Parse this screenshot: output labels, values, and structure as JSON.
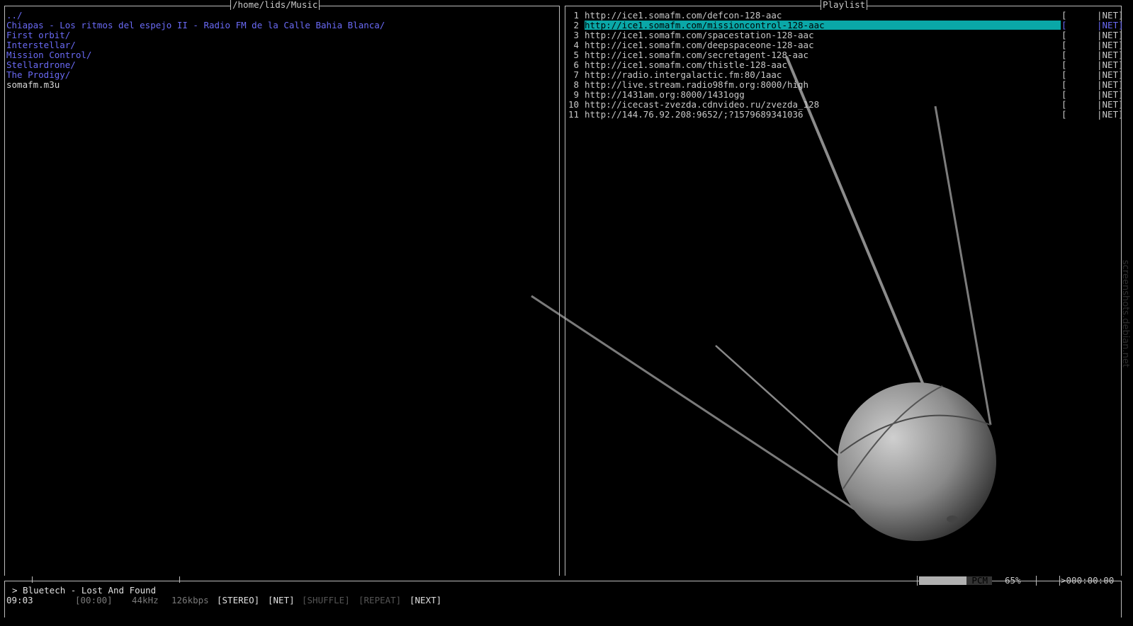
{
  "browser": {
    "title": "/home/lids/Music",
    "items": [
      {
        "name": "../",
        "type": "dir"
      },
      {
        "name": "Chiapas - Los ritmos del espejo II - Radio FM de la Calle Bahia Blanca/",
        "type": "dir"
      },
      {
        "name": "First orbit/",
        "type": "dir"
      },
      {
        "name": "Interstellar/",
        "type": "dir"
      },
      {
        "name": "Mission Control/",
        "type": "dir"
      },
      {
        "name": "Stellardrone/",
        "type": "dir"
      },
      {
        "name": "The Prodigy/",
        "type": "dir"
      },
      {
        "name": "somafm.m3u",
        "type": "file"
      }
    ]
  },
  "playlist": {
    "title": "Playlist",
    "selected_index": 1,
    "items": [
      {
        "num": "1",
        "url": "http://ice1.somafm.com/defcon-128-aac",
        "bracket": "[",
        "tag": "|NET]"
      },
      {
        "num": "2",
        "url": "http://ice1.somafm.com/missioncontrol-128-aac",
        "bracket": "[",
        "tag": "|NET]"
      },
      {
        "num": "3",
        "url": "http://ice1.somafm.com/spacestation-128-aac",
        "bracket": "[",
        "tag": "|NET]"
      },
      {
        "num": "4",
        "url": "http://ice1.somafm.com/deepspaceone-128-aac",
        "bracket": "[",
        "tag": "|NET]"
      },
      {
        "num": "5",
        "url": "http://ice1.somafm.com/secretagent-128-aac",
        "bracket": "[",
        "tag": "|NET]"
      },
      {
        "num": "6",
        "url": "http://ice1.somafm.com/thistle-128-aac",
        "bracket": "[",
        "tag": "|NET]"
      },
      {
        "num": "7",
        "url": "http://radio.intergalactic.fm:80/1aac",
        "bracket": "[",
        "tag": "|NET]"
      },
      {
        "num": "8",
        "url": "http://live.stream.radio98fm.org:8000/high",
        "bracket": "[",
        "tag": "|NET]"
      },
      {
        "num": "9",
        "url": "http://1431am.org:8000/1431ogg",
        "bracket": "[",
        "tag": "|NET]"
      },
      {
        "num": "10",
        "url": "http://icecast-zvezda.cdnvideo.ru/zvezda_128",
        "bracket": "[",
        "tag": "|NET]"
      },
      {
        "num": "11",
        "url": "http://144.76.92.208:9652/;?1579689341036",
        "bracket": "[",
        "tag": "|NET]"
      }
    ]
  },
  "status": {
    "mixer_label": "PCM",
    "volume": "65%",
    "volume_fraction": 0.65,
    "total_time": ">000:00:00",
    "now_playing": "> Bluetech - Lost And Found",
    "elapsed": "09:03",
    "track_time": "[00:00]",
    "rate": "44kHz",
    "bitrate": "126kbps",
    "stereo": "[STEREO]",
    "net": "[NET]",
    "shuffle": "[SHUFFLE]",
    "repeat": "[REPEAT]",
    "next": "[NEXT]"
  },
  "watermark": "screenshots.debian.net",
  "colors": {
    "background": "#000000",
    "directory": "#6a6af5",
    "selection": "#0aa7a7",
    "frame": "#bdbdbd"
  }
}
